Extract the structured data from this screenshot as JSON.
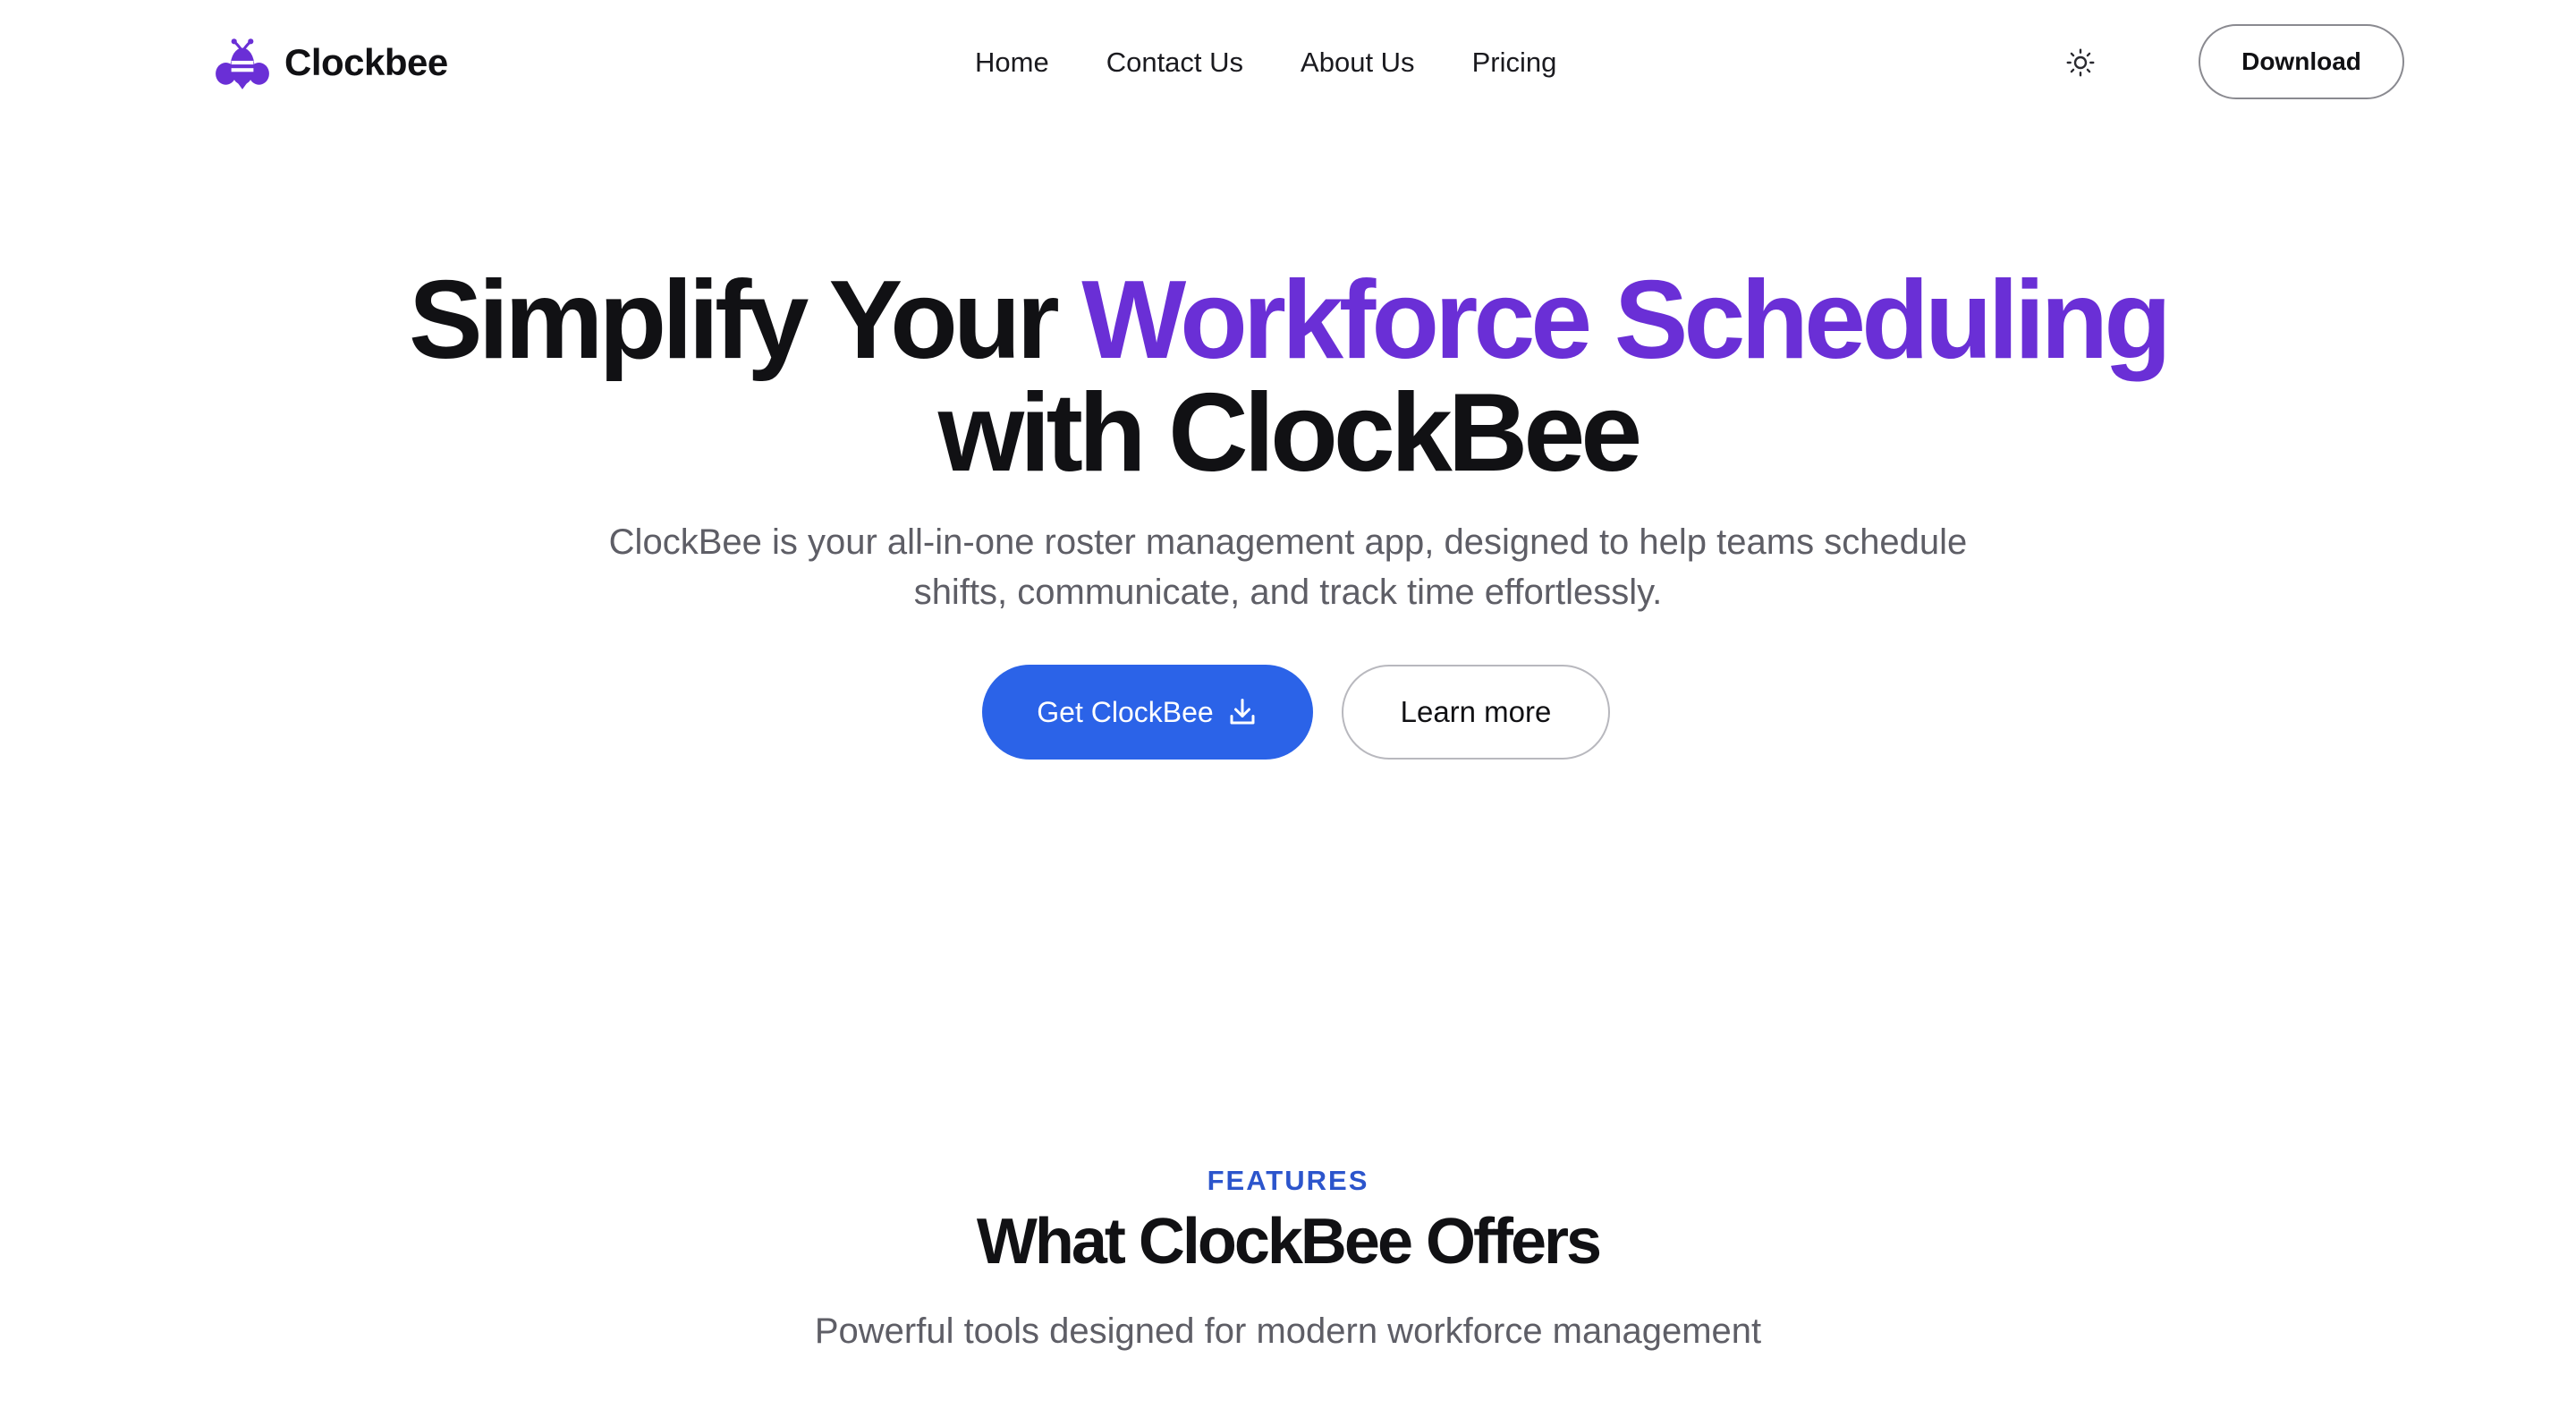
{
  "brand": {
    "name": "Clockbee",
    "logo_icon": "bee-icon",
    "accent_color": "#6a2fd6"
  },
  "nav": {
    "items": [
      {
        "label": "Home"
      },
      {
        "label": "Contact Us"
      },
      {
        "label": "About Us"
      },
      {
        "label": "Pricing"
      }
    ]
  },
  "header": {
    "theme_toggle_icon": "sun-icon",
    "download_label": "Download"
  },
  "hero": {
    "title_part1": "Simplify Your ",
    "title_accent": "Workforce Scheduling",
    "title_part2": "with ClockBee",
    "subtitle": "ClockBee is your all-in-one roster management app, designed to help teams schedule shifts, communicate, and track time effortlessly.",
    "primary_cta_label": "Get ClockBee",
    "primary_cta_icon": "download-icon",
    "primary_cta_color": "#2b63e8",
    "secondary_cta_label": "Learn more"
  },
  "features": {
    "eyebrow": "FEATURES",
    "title": "What ClockBee Offers",
    "subtitle": "Powerful tools designed for modern workforce management",
    "eyebrow_color": "#2c55cc"
  }
}
